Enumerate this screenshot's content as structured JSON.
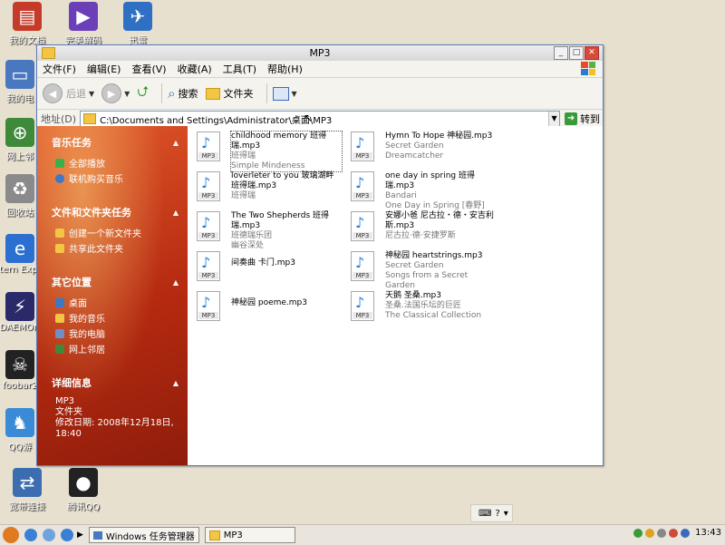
{
  "desktop": {
    "icons": [
      {
        "label": "我的文档",
        "name": "my-documents-icon"
      },
      {
        "label": "完美解码",
        "name": "media-player-icon"
      },
      {
        "label": "迅雷",
        "name": "thunder-icon"
      },
      {
        "label": "我的电",
        "name": "my-computer-icon"
      },
      {
        "label": "网上邻",
        "name": "network-icon"
      },
      {
        "label": "回收站",
        "name": "recycle-bin-icon"
      },
      {
        "label": "Intern Explor",
        "name": "internet-explorer-icon"
      },
      {
        "label": "DAEMON",
        "name": "daemon-tools-icon"
      },
      {
        "label": "foobar2",
        "name": "foobar-icon"
      },
      {
        "label": "QQ游",
        "name": "qq-game-icon"
      },
      {
        "label": "宽带连接",
        "name": "broadband-icon"
      },
      {
        "label": "腾讯QQ",
        "name": "qq-icon"
      }
    ]
  },
  "window": {
    "title": "MP3",
    "menu": [
      "文件(F)",
      "编辑(E)",
      "查看(V)",
      "收藏(A)",
      "工具(T)",
      "帮助(H)"
    ],
    "toolbar": {
      "back": "后退",
      "search": "搜索",
      "folders": "文件夹"
    },
    "address": {
      "label": "地址(D)",
      "path": "C:\\Documents and Settings\\Administrator\\桌面\\MP3",
      "go": "转到"
    }
  },
  "sidebar": {
    "music_tasks": {
      "title": "音乐任务",
      "items": [
        "全部播放",
        "联机购买音乐"
      ]
    },
    "file_tasks": {
      "title": "文件和文件夹任务",
      "items": [
        "创建一个新文件夹",
        "共享此文件夹"
      ]
    },
    "other_places": {
      "title": "其它位置",
      "items": [
        "桌面",
        "我的音乐",
        "我的电脑",
        "网上邻居"
      ]
    },
    "details": {
      "title": "详细信息",
      "name": "MP3",
      "type": "文件夹",
      "modified_label": "修改日期: 2008年12月18日,",
      "modified_time": "18:40"
    }
  },
  "files": [
    {
      "name": "childhood memory 班得瑞.mp3",
      "line2": "班得瑞",
      "line3": "Simple Mindeness",
      "selected": true
    },
    {
      "name": "Hymn To Hope 神秘园.mp3",
      "line2": "Secret Garden",
      "line3": "Dreamcatcher"
    },
    {
      "name": "loverleter to you 玻璃湖畔 班得瑞.mp3",
      "line2": "班得瑞",
      "line3": ""
    },
    {
      "name": "one day in spring 班得瑞.mp3",
      "line2": "Bandari",
      "line3": "One Day in Spring [春野]"
    },
    {
      "name": "The Two Shepherds 班得瑞.mp3",
      "line2": "班德瑞乐团",
      "line3": "幽谷深处"
    },
    {
      "name": "安娜小爸 尼古拉・德・安吉利斯.mp3",
      "line2": "尼古拉·德·安捷罗斯",
      "line3": ""
    },
    {
      "name": "间奏曲 卡门.mp3",
      "line2": "",
      "line3": ""
    },
    {
      "name": "神秘园 heartstrings.mp3",
      "line2": "Secret Garden",
      "line3": "Songs from a Secret Garden"
    },
    {
      "name": "神秘园 poeme.mp3",
      "line2": "",
      "line3": ""
    },
    {
      "name": "天鹅 圣桑.mp3",
      "line2": "圣桑.法国乐坛的巨匠",
      "line3": "The Classical Collection"
    }
  ],
  "file_badge": "MP3",
  "taskbar": {
    "tasks": [
      "Windows 任务管理器",
      "MP3"
    ],
    "clock": "13:43"
  },
  "colors": {
    "sidebar_top": "#e0572a",
    "sidebar_bottom": "#8f1d0b",
    "note_blue": "#2a7ad2"
  }
}
